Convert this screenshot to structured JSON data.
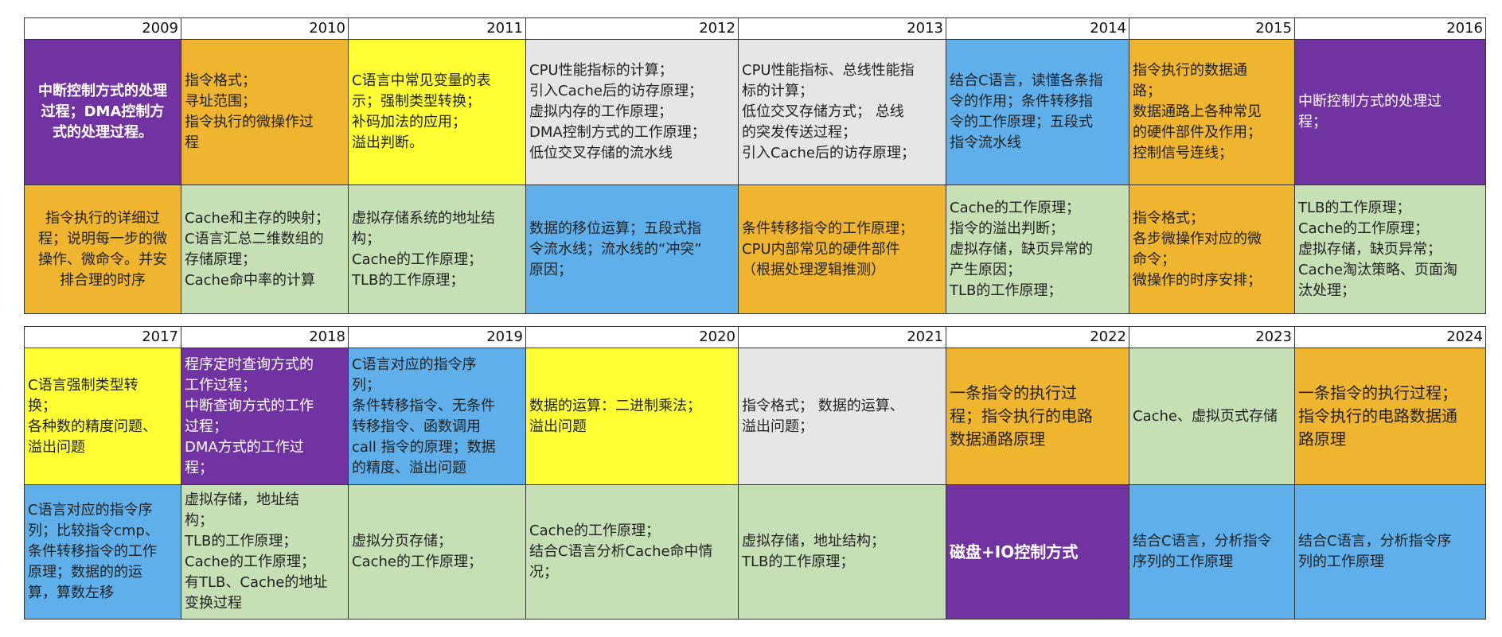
{
  "colors": {
    "purple": "#7133a1",
    "orange": "#f0b52f",
    "yellow": "#ffff33",
    "gray": "#e6e6e6",
    "blue": "#5fb0ea",
    "green": "#c7dfb5"
  },
  "top": {
    "years": [
      "2009",
      "2010",
      "2011",
      "2012",
      "2013",
      "2014",
      "2015",
      "2016"
    ],
    "row1": [
      "中断控制方式的处理\n过程；DMA控制方\n式的处理过程。",
      "指令格式；\n寻址范围；\n指令执行的微操作过\n程",
      "C语言中常见变量的表\n示；强制类型转换；\n补码加法的应用；\n溢出判断。",
      "CPU性能指标的计算；\n引入Cache后的访存原理；\n虚拟内存的工作原理；\nDMA控制方式的工作原理；\n低位交叉存储的流水线",
      "CPU性能指标、总线性能指\n标的计算；\n低位交叉存储方式；  总线\n的突发传送过程；\n引入Cache后的访存原理；",
      "结合C语言，读懂各条指\n令的作用；条件转移指\n令的工作原理；五段式\n指令流水线",
      "指令执行的数据通\n路；\n数据通路上各种常见\n的硬件部件及作用；\n控制信号连线；",
      "中断控制方式的处理过\n程；"
    ],
    "row2": [
      "指令执行的详细过\n程；说明每一步的微\n操作、微命令。并安\n排合理的时序",
      "Cache和主存的映射；\nC语言汇总二维数组的\n存储原理；\nCache命中率的计算",
      "虚拟存储系统的地址结\n构；\nCache的工作原理；\nTLB的工作原理；",
      "数据的移位运算；五段式指\n令流水线；流水线的“冲突”\n原因；",
      "条件转移指令的工作原理；\nCPU内部常见的硬件部件\n（根据处理逻辑推测）",
      "Cache的工作原理；\n指令的溢出判断；\n虚拟存储，缺页异常的\n产生原因；\nTLB的工作原理；",
      "指令格式；\n各步微操作对应的微\n命令；\n微操作的时序安排；",
      "TLB的工作原理；\nCache的工作原理；\n虚拟存储，缺页异常；\nCache淘汰策略、页面淘\n汰处理；"
    ]
  },
  "bottom": {
    "years": [
      "2017",
      "2018",
      "2019",
      "2020",
      "2021",
      "2022",
      "2023",
      "2024"
    ],
    "row1": [
      "C语言强制类型转\n换；\n各种数的精度问题、\n溢出问题",
      "程序定时查询方式的\n工作过程；\n中断查询方式的工作\n过程；\nDMA方式的工作过\n程；",
      "C语言对应的指令序\n列；\n条件转移指令、无条件\n转移指令、函数调用\ncall 指令的原理；数据\n的精度、溢出问题",
      "数据的运算：二进制乘法；\n溢出问题",
      "指令格式；  数据的运算、\n溢出问题；",
      "一条指令的执行过\n程；指令执行的电路\n数据通路原理",
      "Cache、虚拟页式存储",
      "一条指令的执行过程；\n指令执行的电路数据通\n路原理"
    ],
    "row2": [
      "C语言对应的指令序\n列；比较指令cmp、\n条件转移指令的工作\n原理；数据的的运\n算，算数左移",
      "虚拟存储，地址结\n构；\nTLB的工作原理；\nCache的工作原理；\n有TLB、Cache的地址\n变换过程",
      "虚拟分页存储；\nCache的工作原理；",
      "Cache的工作原理；\n结合C语言分析Cache命中情\n况；",
      "虚拟存储，地址结构；\nTLB的工作原理；",
      "磁盘+IO控制方式",
      "结合C语言，分析指令\n序列的工作原理",
      "结合C语言，分析指令序\n列的工作原理"
    ]
  }
}
